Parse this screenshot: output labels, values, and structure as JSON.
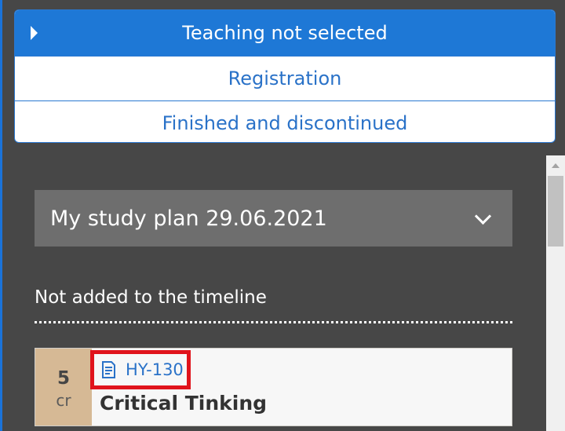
{
  "tabs": [
    {
      "label": "Teaching not selected",
      "active": true
    },
    {
      "label": "Registration",
      "active": false
    },
    {
      "label": "Finished and discontinued",
      "active": false
    }
  ],
  "study_plan": {
    "selected": "My study plan 29.06.2021"
  },
  "section": {
    "heading": "Not added to the timeline"
  },
  "course": {
    "credits": "5",
    "credits_unit": "cr",
    "code": "HY-130",
    "name": "Critical Tinking",
    "icon": "document-icon"
  },
  "colors": {
    "background": "#474747",
    "accent": "#1e78d6",
    "link": "#2a72c8",
    "credit_box": "#d6b995",
    "highlight": "#e0131b"
  }
}
